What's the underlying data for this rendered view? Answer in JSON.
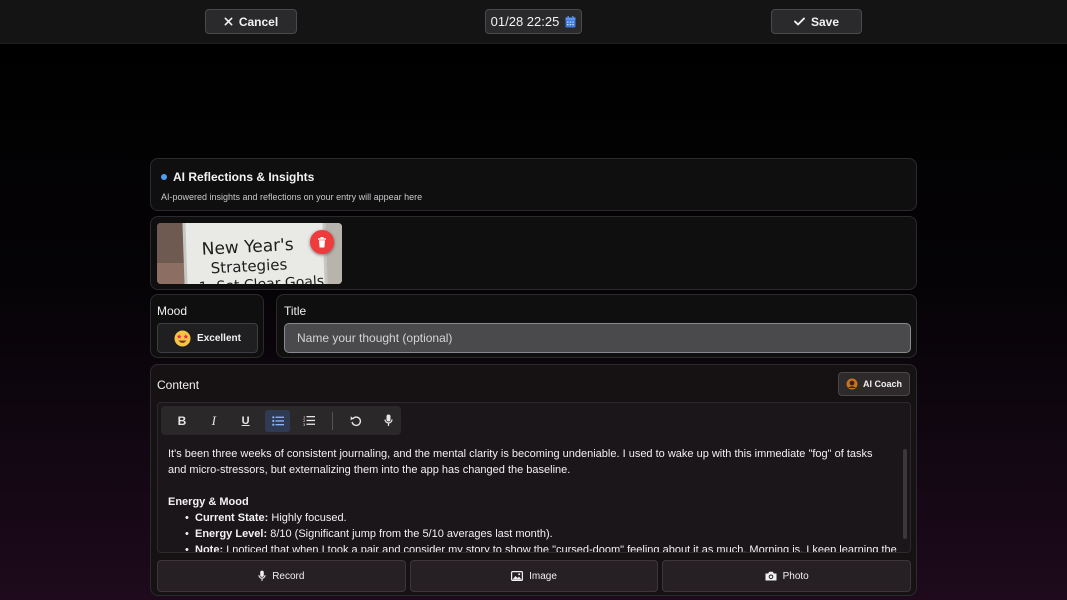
{
  "topbar": {
    "cancel_label": "Cancel",
    "datetime": "01/28 22:25",
    "save_label": "Save"
  },
  "ai_panel": {
    "title": "AI Reflections & Insights",
    "subtitle": "AI-powered insights and reflections on your entry will appear here"
  },
  "attachment": {
    "image_text_lines": [
      "New Year's",
      "Strategies",
      "1. Set Clear Goals"
    ]
  },
  "mood": {
    "label": "Mood",
    "value": "Excellent"
  },
  "title_field": {
    "label": "Title",
    "value": "",
    "placeholder": "Name your thought (optional)"
  },
  "content": {
    "label": "Content",
    "ai_coach_label": "AI Coach",
    "paragraph": "It's been three weeks of consistent journaling, and the mental clarity is becoming undeniable. I used to wake up with this immediate \"fog\" of tasks and micro-stressors, but externalizing them into the app has changed the baseline.",
    "heading": "Energy & Mood",
    "bullets": [
      {
        "key": "Current State:",
        "text": "Highly focused."
      },
      {
        "key": "Energy Level:",
        "text": "8/10 (Significant jump from the 5/10 averages last month)."
      },
      {
        "key": "Note:",
        "text": "I noticed that when I took a pair and consider my story to show the \"cursed-doom\" feeling about it as much. Morning is. I keep learning the"
      }
    ]
  },
  "actions": {
    "record_label": "Record",
    "image_label": "Image",
    "photo_label": "Photo"
  },
  "colors": {
    "accent": "#4f9cf6",
    "delete": "#ef3b3b",
    "active_tool": "#2f3b52"
  }
}
